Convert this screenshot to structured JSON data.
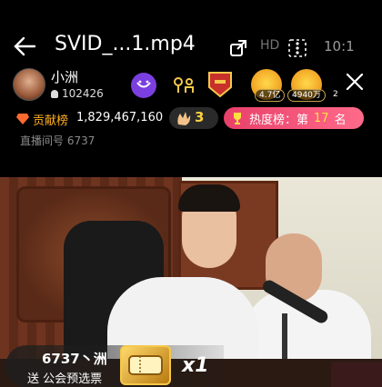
{
  "player": {
    "filename": "SVID_...1.mp4",
    "clock": "10:1"
  },
  "streamer": {
    "name": "小洲",
    "fans": "102426"
  },
  "fans_bar": [
    {
      "count": "4.7亿"
    },
    {
      "count": "4940万"
    },
    {
      "count": "2"
    }
  ],
  "contribution": {
    "label": "贡献榜",
    "value": "1,829,467,160"
  },
  "clap": {
    "count": "3"
  },
  "hot": {
    "label": "热度榜：第",
    "rank": "17",
    "suffix": "名"
  },
  "room": {
    "label": "直播间号 6737"
  },
  "gift": {
    "user": "6737丶洲",
    "text": "送 公会预选票",
    "multiplier": "x1"
  },
  "colors": {
    "accent_pink": "#e8406a",
    "gold": "#ffb020",
    "purple": "#7b3fe0"
  }
}
